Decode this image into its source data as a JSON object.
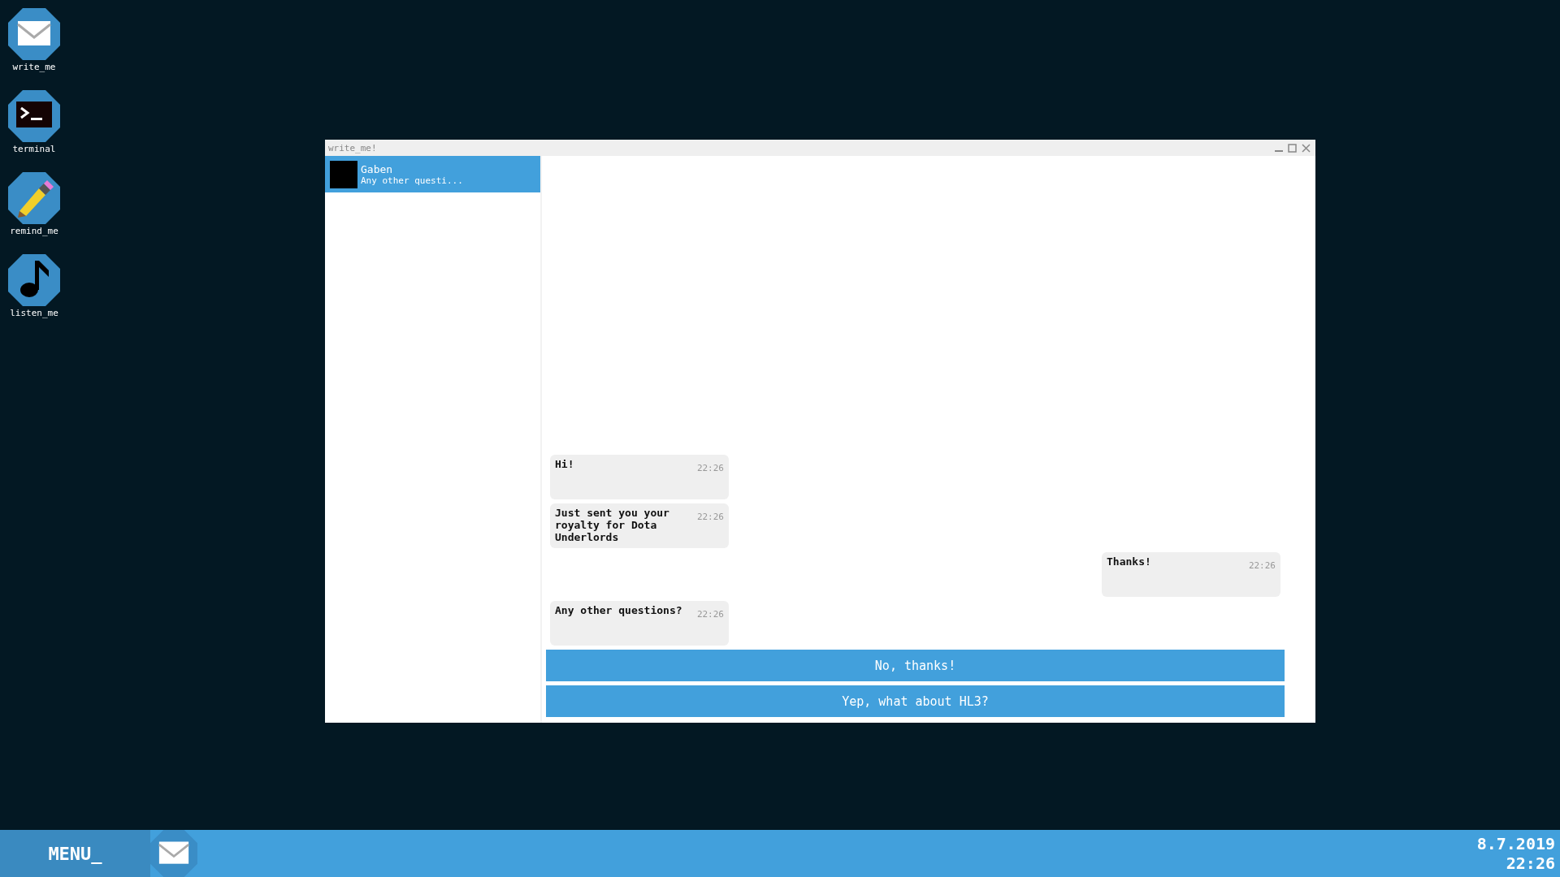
{
  "desktop_icons": [
    {
      "kind": "mail",
      "label": "write_me"
    },
    {
      "kind": "terminal",
      "label": "terminal"
    },
    {
      "kind": "pencil",
      "label": "remind_me"
    },
    {
      "kind": "music",
      "label": "listen_me"
    }
  ],
  "window": {
    "title": "write_me!",
    "conversations": [
      {
        "name": "Gaben",
        "preview": "Any other questi...",
        "selected": true
      }
    ],
    "messages": [
      {
        "kind": "incoming",
        "text": "Hi!",
        "time": "22:26"
      },
      {
        "kind": "incoming",
        "text": "Just sent you your royalty for Dota Underlords",
        "time": "22:26"
      },
      {
        "kind": "outgoing",
        "text": "Thanks!",
        "time": "22:26"
      },
      {
        "kind": "incoming",
        "text": "Any other questions?",
        "time": "22:26"
      }
    ],
    "replies": [
      "No, thanks!",
      "Yep, what about HL3?"
    ]
  },
  "taskbar": {
    "menu": "MENU_",
    "apps": [
      {
        "kind": "mail"
      }
    ],
    "date": "8.7.2019",
    "time": "22:26"
  }
}
